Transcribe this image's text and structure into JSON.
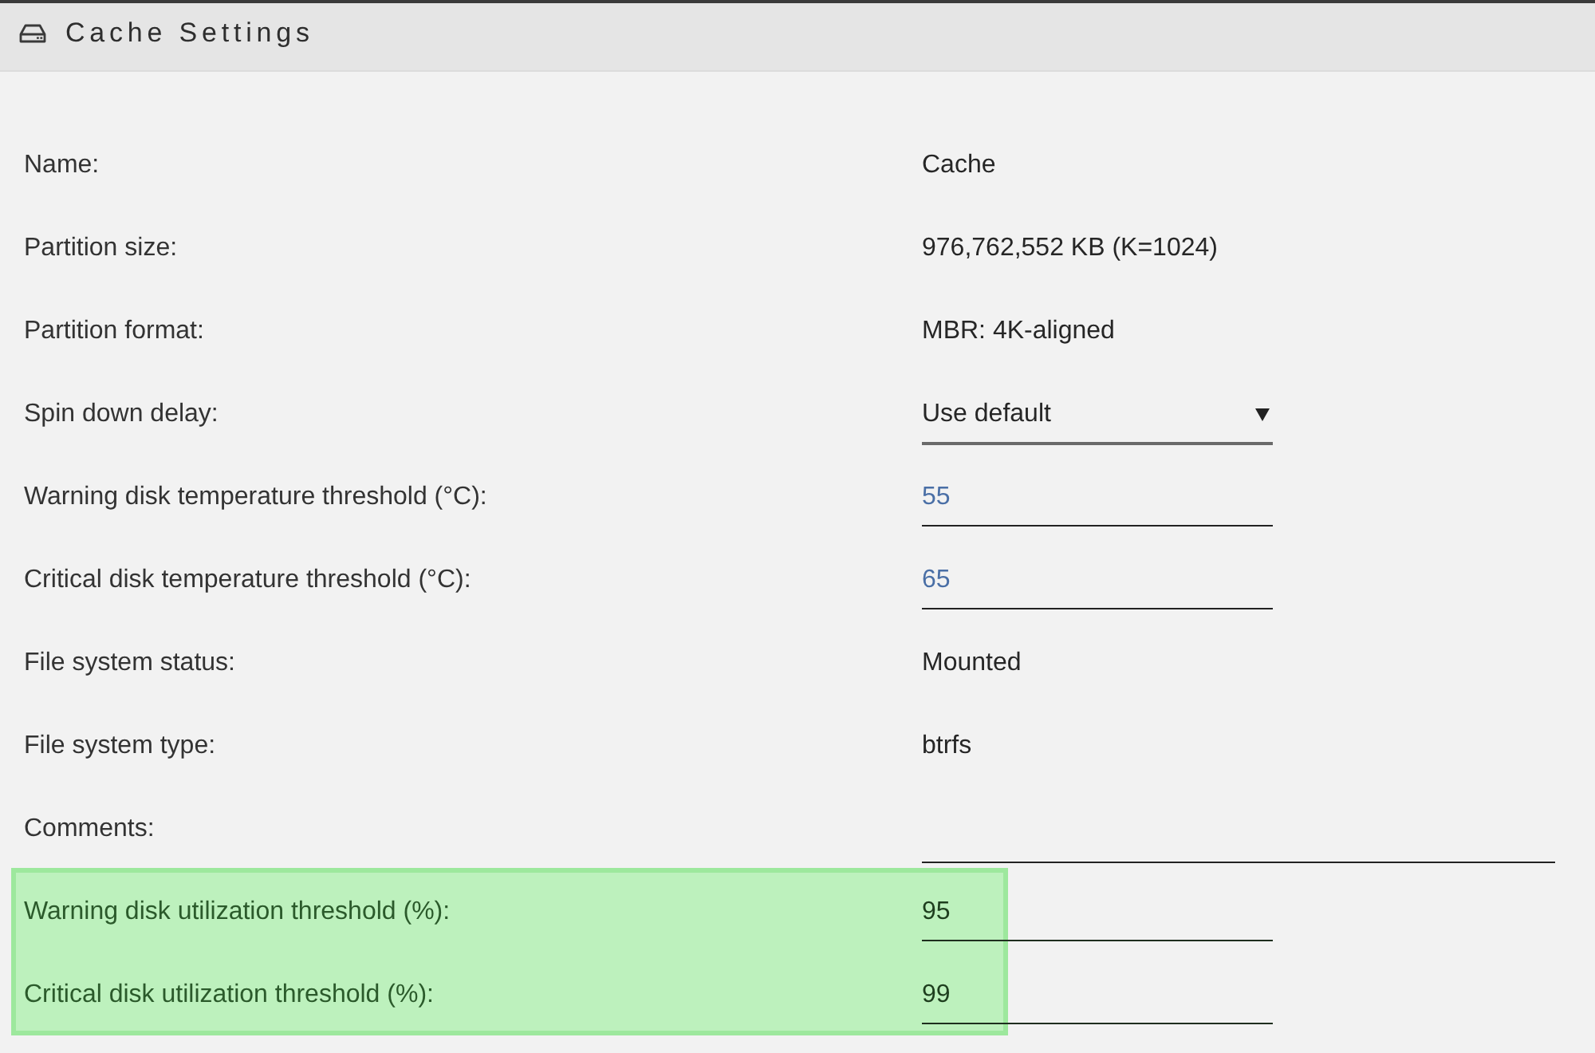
{
  "header": {
    "title": "Cache Settings"
  },
  "fields": [
    {
      "label": "Name:",
      "kind": "text",
      "value": "Cache",
      "highlighted": false
    },
    {
      "label": "Partition size:",
      "kind": "text",
      "value": "976,762,552 KB (K=1024)",
      "highlighted": false
    },
    {
      "label": "Partition format:",
      "kind": "text",
      "value": "MBR: 4K-aligned",
      "highlighted": false
    },
    {
      "label": "Spin down delay:",
      "kind": "select",
      "value": "Use default",
      "highlighted": false
    },
    {
      "label": "Warning disk temperature threshold (°C):",
      "kind": "number",
      "value": "55",
      "highlighted": false
    },
    {
      "label": "Critical disk temperature threshold (°C):",
      "kind": "number",
      "value": "65",
      "highlighted": false
    },
    {
      "label": "File system status:",
      "kind": "text",
      "value": "Mounted",
      "highlighted": false
    },
    {
      "label": "File system type:",
      "kind": "text",
      "value": "btrfs",
      "highlighted": false
    },
    {
      "label": "Comments:",
      "kind": "comment",
      "highlighted": false
    },
    {
      "label": "Warning disk utilization threshold (%):",
      "kind": "number",
      "value": "95",
      "highlighted": true
    },
    {
      "label": "Critical disk utilization threshold (%):",
      "kind": "number",
      "value": "99",
      "highlighted": true
    }
  ]
}
